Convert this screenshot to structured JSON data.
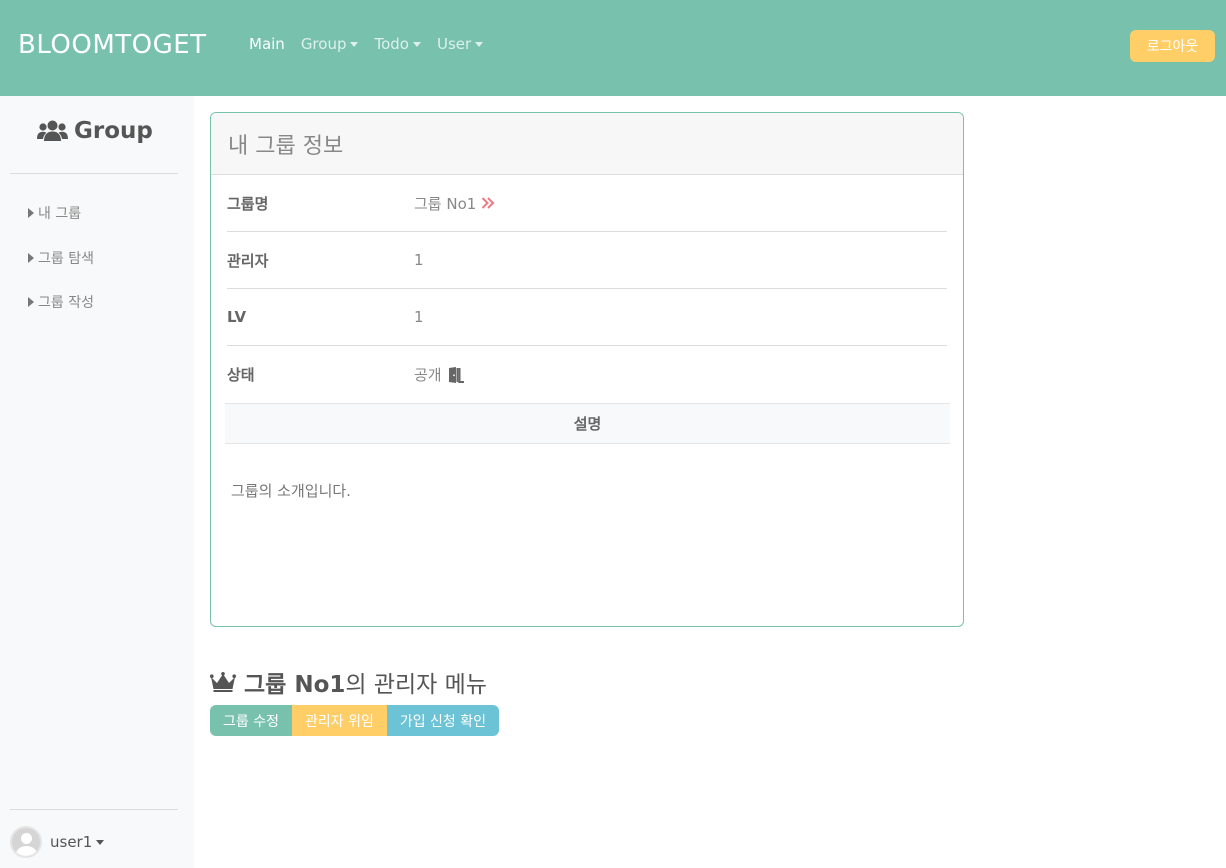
{
  "navbar": {
    "brand": "BLOOMTOGET",
    "links": [
      {
        "label": "Main",
        "dropdown": false,
        "active": true
      },
      {
        "label": "Group",
        "dropdown": true,
        "active": false
      },
      {
        "label": "Todo",
        "dropdown": true,
        "active": false
      },
      {
        "label": "User",
        "dropdown": true,
        "active": false
      }
    ],
    "logout_label": "로그아웃",
    "color": "#78c2ad"
  },
  "sidebar": {
    "title": "Group",
    "title_icon": "users-icon",
    "items": [
      {
        "label": "내 그룹"
      },
      {
        "label": "그룹 탐색"
      },
      {
        "label": "그룹 작성"
      }
    ],
    "user": {
      "name": "user1"
    }
  },
  "card": {
    "header": "내 그룹 정보",
    "rows": [
      {
        "label": "그룹명",
        "value": "그룹 No1",
        "icon": "double-chevron-right-icon"
      },
      {
        "label": "관리자",
        "value": "1"
      },
      {
        "label": "LV",
        "value": "1"
      },
      {
        "label": "상태",
        "value": "공개",
        "icon": "door-open-icon"
      }
    ],
    "description_header": "설명",
    "description": "그룹의 소개입니다."
  },
  "admin_menu": {
    "icon": "crown-icon",
    "group_name": "그룹 No1",
    "title_suffix": "의 관리자 메뉴",
    "buttons": [
      {
        "label": "그룹 수정",
        "color": "#78c2ad"
      },
      {
        "label": "관리자 위임",
        "color": "#ffce67"
      },
      {
        "label": "가입 신청 확인",
        "color": "#6cc3d5"
      }
    ]
  }
}
